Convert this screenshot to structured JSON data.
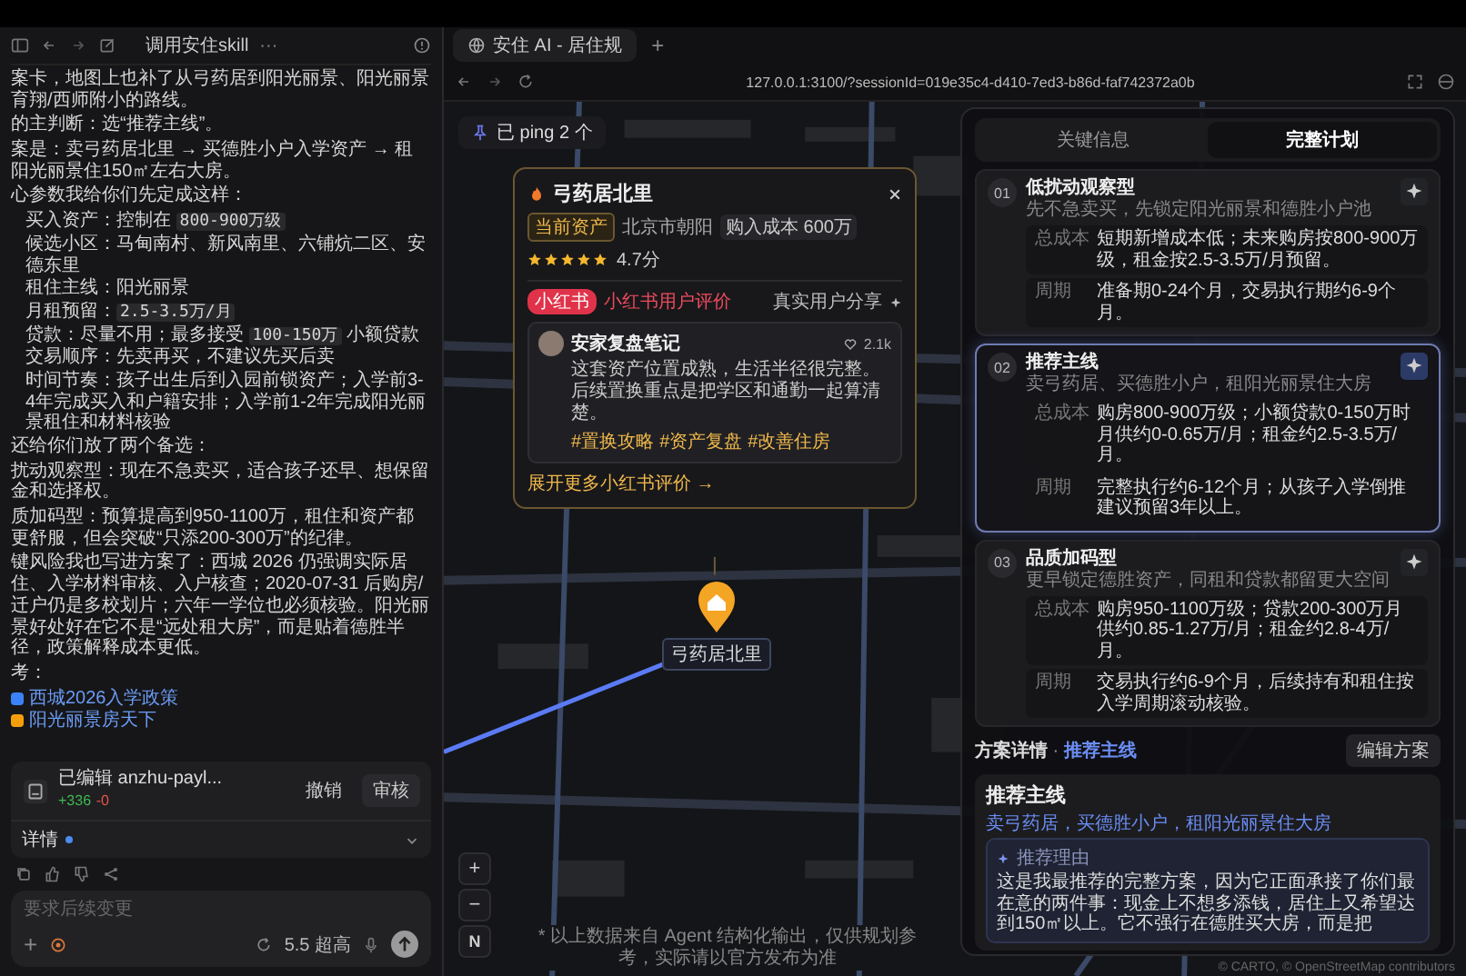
{
  "chat": {
    "header_title": "调用安住skill",
    "menu": "···",
    "blocks": [
      {
        "kind": "para",
        "parts": [
          {
            "text": "案卡，地图上也补了从弓药居到阳光丽景、阳光丽景育翔/西师附小的路线。",
            "code": false
          }
        ]
      },
      {
        "kind": "para",
        "parts": [
          {
            "text": "的主判断：选“推荐主线”。",
            "code": false
          }
        ]
      },
      {
        "kind": "para",
        "parts": [
          {
            "text": "案是：卖弓药居北里 → 买德胜小户入学资产 → 租阳光丽景住150㎡左右大房。",
            "code": false
          }
        ]
      },
      {
        "kind": "para",
        "parts": [
          {
            "text": "心参数我给你们先定成这样：",
            "code": false
          }
        ]
      },
      {
        "kind": "item",
        "parts": [
          {
            "text": "买入资产：控制在 ",
            "code": false
          },
          {
            "text": "800-900万级",
            "code": true
          }
        ]
      },
      {
        "kind": "item",
        "parts": [
          {
            "text": "候选小区：马甸南村、新风南里、六铺炕二区、安德东里",
            "code": false
          }
        ]
      },
      {
        "kind": "item",
        "parts": [
          {
            "text": "租住主线：阳光丽景",
            "code": false
          }
        ]
      },
      {
        "kind": "item",
        "parts": [
          {
            "text": "月租预留：",
            "code": false
          },
          {
            "text": "2.5-3.5万/月",
            "code": true
          }
        ]
      },
      {
        "kind": "item",
        "parts": [
          {
            "text": "贷款：尽量不用；最多接受 ",
            "code": false
          },
          {
            "text": "100-150万",
            "code": true
          },
          {
            "text": " 小额贷款",
            "code": false
          }
        ]
      },
      {
        "kind": "item",
        "parts": [
          {
            "text": "交易顺序：先卖再买，不建议先买后卖",
            "code": false
          }
        ]
      },
      {
        "kind": "item",
        "parts": [
          {
            "text": "时间节奏：孩子出生后到入园前锁资产；入学前3-4年完成买入和户籍安排；入学前1-2年完成阳光丽景租住和材料核验",
            "code": false
          }
        ]
      },
      {
        "kind": "para",
        "parts": [
          {
            "text": "还给你们放了两个备选：",
            "code": false
          }
        ]
      },
      {
        "kind": "para",
        "parts": [
          {
            "text": "扰动观察型：现在不急卖买，适合孩子还早、想保留金和选择权。",
            "code": false
          }
        ]
      },
      {
        "kind": "para",
        "parts": [
          {
            "text": "质加码型：预算提高到950-1100万，租住和资产都更舒服，但会突破“只添200-300万”的纪律。",
            "code": false
          }
        ]
      },
      {
        "kind": "para",
        "parts": [
          {
            "text": "键风险我也写进方案了：西城 2026 仍强调实际居住、入学材料审核、入户核查；2020-07-31 后购房/迁户仍是多校划片；六年一学位也必须核验。阳光丽景好处好在它不是“远处租大房”，而是贴着德胜半径，政策解释成本更低。",
            "code": false
          }
        ]
      },
      {
        "kind": "para",
        "parts": [
          {
            "text": "考：",
            "code": false
          }
        ]
      },
      {
        "kind": "link",
        "text": "西城2026入学政策",
        "color": "#3b82f6"
      },
      {
        "kind": "link",
        "text": "阳光丽景房天下",
        "color": "#f59e0b"
      }
    ],
    "edit_card": {
      "label": "已编辑 anzhu-payl...",
      "added": "+336",
      "removed": "-0",
      "undo": "撤销",
      "review": "审核",
      "details": "详情"
    },
    "input": {
      "placeholder": "要求后续变更",
      "add": "+",
      "model": "5.5 超高"
    }
  },
  "browser": {
    "tab": "安住 AI - 居住规",
    "new_tab": "+",
    "url": "127.0.0.1:3100/?sessionId=019e35c4-d410-7ed3-b86d-faf742372a0b"
  },
  "map": {
    "ping": "已 ping 2 个",
    "zoom_in": "+",
    "zoom_out": "−",
    "compass": "N",
    "popup": {
      "title": "弓药居北里",
      "tag": "当前资产",
      "district": "北京市朝阳",
      "cost": "购入成本 600万",
      "stars": 5,
      "rating": "4.7分",
      "source_badge": "小红书",
      "source_title": "小红书用户评价",
      "share": "真实用户分享",
      "author": "安家复盘笔记",
      "likes": "2.1k",
      "review": "这套资产位置成熟，生活半径很完整。后续置换重点是把学区和通勤一起算清楚。",
      "hashtags": [
        "#置换攻略",
        "#资产复盘",
        "#改善住房"
      ],
      "more": "展开更多小红书评价 →"
    },
    "marker_label": "弓药居北里",
    "attribution": "© CARTO, © OpenStreetMap contributors",
    "disclaimer": "* 以上数据来自 Agent 结构化输出，仅供规划参考，实际请以官方发布为准"
  },
  "panel": {
    "tabs": [
      {
        "label": "关键信息",
        "selected": false
      },
      {
        "label": "完整计划",
        "selected": true
      }
    ],
    "plans": [
      {
        "number": "01",
        "title": "低扰动观察型",
        "subtitle": "先不急卖买，先锁定阳光丽景和德胜小户池",
        "selected": false,
        "rows": [
          {
            "label": "总成本",
            "text": "短期新增成本低；未来购房按800-900万级，租金按2.5-3.5万/月预留。"
          },
          {
            "label": "周期",
            "text": "准备期0-24个月，交易执行期约6-9个月。"
          }
        ]
      },
      {
        "number": "02",
        "title": "推荐主线",
        "subtitle": "卖弓药居、买德胜小户，租阳光丽景住大房",
        "selected": true,
        "rows": [
          {
            "label": "总成本",
            "text": "购房800-900万级；小额贷款0-150万时月供约0-0.65万/月；租金约2.5-3.5万/月。"
          },
          {
            "label": "周期",
            "text": "完整执行约6-12个月；从孩子入学倒推建议预留3年以上。"
          }
        ]
      },
      {
        "number": "03",
        "title": "品质加码型",
        "subtitle": "更早锁定德胜资产，同租和贷款都留更大空间",
        "selected": false,
        "rows": [
          {
            "label": "总成本",
            "text": "购房950-1100万级；贷款200-300万月供约0.85-1.27万/月；租金约2.8-4万/月。"
          },
          {
            "label": "周期",
            "text": "交易执行约6-9个月，后续持有和租住按入学周期滚动核验。"
          }
        ]
      }
    ],
    "detail_heading": "方案详情",
    "detail_separator": "·",
    "detail_plan": "推荐主线",
    "edit": "编辑方案",
    "detail": {
      "title": "推荐主线",
      "subtitle": "卖弓药居，买德胜小户，租阳光丽景住大房",
      "reason_label": "推荐理由",
      "reason": "这是我最推荐的完整方案，因为它正面承接了你们最在意的两件事：现金上不想多添钱，居住上又希望达到150㎡以上。它不强行在德胜买大房，而是把"
    }
  }
}
